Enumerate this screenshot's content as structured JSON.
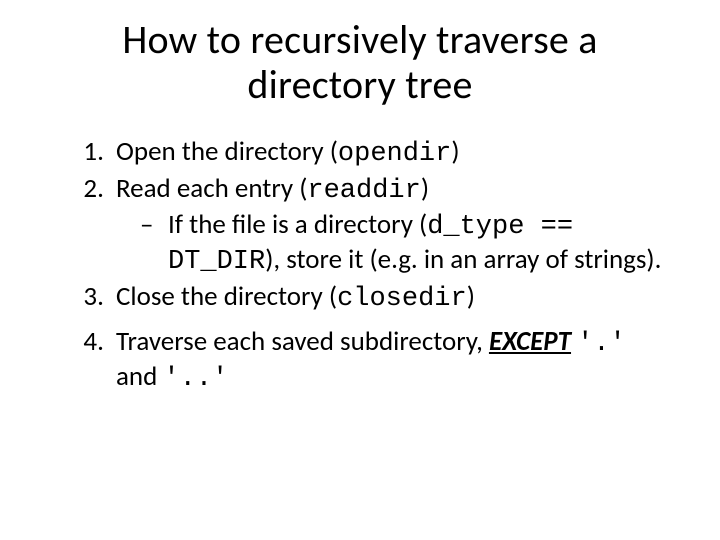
{
  "title": "How to recursively traverse a directory tree",
  "items": {
    "i1": {
      "pre": "Open the directory (",
      "code": "opendir",
      "post": ")"
    },
    "i2": {
      "pre": "Read each entry (",
      "code": "readdir",
      "post": ")"
    },
    "i2sub": {
      "pre": "If the file is a directory (",
      "code": "d_type == DT_DIR",
      "post": "), store it (e.g. in an array of strings)."
    },
    "i3": {
      "pre": "Close the directory (",
      "code": "closedir",
      "post": ")"
    },
    "i4": {
      "pre": "Traverse each saved subdirectory, ",
      "except": "EXCEPT",
      "mid": " ",
      "code1": "'.'",
      "and": " and ",
      "code2": "'..'"
    }
  }
}
